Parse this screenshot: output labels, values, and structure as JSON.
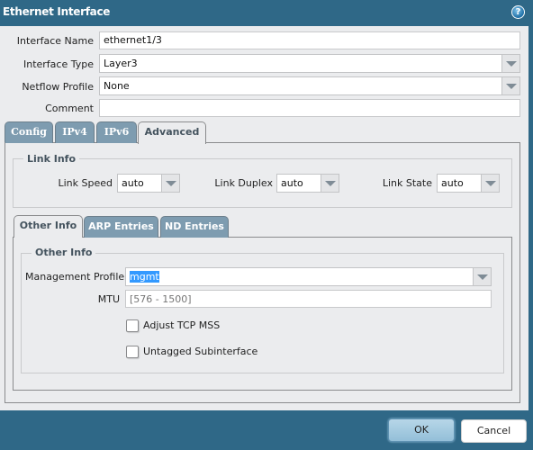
{
  "dialog": {
    "title": "Ethernet Interface",
    "help_icon": "question-mark-icon"
  },
  "form": {
    "interface_name": {
      "label": "Interface Name",
      "value": "ethernet1/3"
    },
    "interface_type": {
      "label": "Interface Type",
      "value": "Layer3"
    },
    "netflow_profile": {
      "label": "Netflow Profile",
      "value": "None"
    },
    "comment": {
      "label": "Comment",
      "value": ""
    }
  },
  "tabs": [
    {
      "label": "Config",
      "active": false
    },
    {
      "label": "IPv4",
      "active": false
    },
    {
      "label": "IPv6",
      "active": false
    },
    {
      "label": "Advanced",
      "active": true
    }
  ],
  "link_info": {
    "legend": "Link Info",
    "link_speed": {
      "label": "Link Speed",
      "value": "auto"
    },
    "link_duplex": {
      "label": "Link Duplex",
      "value": "auto"
    },
    "link_state": {
      "label": "Link State",
      "value": "auto"
    }
  },
  "sub_tabs": [
    {
      "label": "Other Info",
      "active": true
    },
    {
      "label": "ARP Entries",
      "active": false
    },
    {
      "label": "ND Entries",
      "active": false
    }
  ],
  "other_info": {
    "legend": "Other Info",
    "management_profile": {
      "label": "Management Profile",
      "value": "mgmt"
    },
    "mtu": {
      "label": "MTU",
      "value": "",
      "placeholder": "[576 - 1500]"
    },
    "adjust_tcp_mss": {
      "label": "Adjust TCP MSS",
      "checked": false
    },
    "untagged_subinterface": {
      "label": "Untagged Subinterface",
      "checked": false
    }
  },
  "buttons": {
    "ok": "OK",
    "cancel": "Cancel"
  },
  "colors": {
    "frame": "#2f6887",
    "panel": "#ebecee",
    "tab_inactive": "#7e9cb0",
    "selection": "#3399ff"
  }
}
